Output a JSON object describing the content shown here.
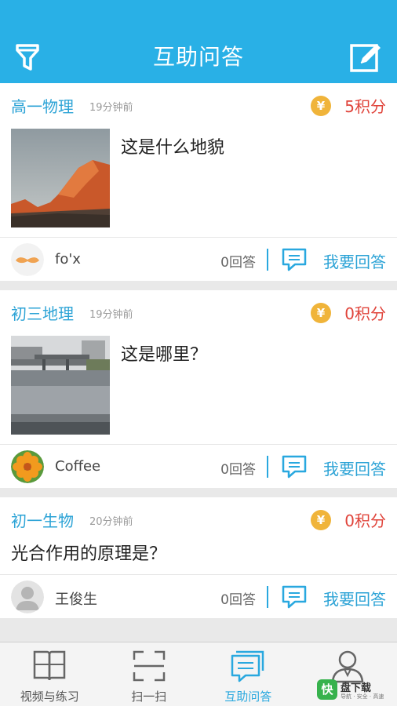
{
  "app_bar": {
    "title": "互助问答",
    "filter_icon": "filter-icon",
    "compose_icon": "compose-icon"
  },
  "questions": [
    {
      "subject": "高一物理",
      "time": "19分钟前",
      "points": "5积分",
      "question": "这是什么地貌",
      "image": "rock-landscape-photo",
      "user": "fo'x",
      "avatar": "mustache-avatar",
      "answers": "0回答",
      "reply_label": "我要回答"
    },
    {
      "subject": "初三地理",
      "time": "19分钟前",
      "points": "0积分",
      "question": "这是哪里？",
      "image": "river-bridge-photo",
      "user": "Coffee",
      "avatar": "flower-avatar",
      "answers": "0回答",
      "reply_label": "我要回答"
    },
    {
      "subject": "初一生物",
      "time": "20分钟前",
      "points": "0积分",
      "question": "光合作用的原理是？",
      "user": "王俊生",
      "avatar": "default-person-avatar",
      "answers": "0回答",
      "reply_label": "我要回答"
    }
  ],
  "coin_symbol": "¥",
  "tabs": [
    {
      "label": "视频与练习",
      "icon": "book-icon"
    },
    {
      "label": "扫一扫",
      "icon": "scan-icon"
    },
    {
      "label": "互助问答",
      "icon": "chat-icon",
      "active": true
    },
    {
      "label": "",
      "icon": "person-icon"
    }
  ],
  "watermark": {
    "badge": "快",
    "text": "盘下载",
    "sub": "导航 · 安全 · 高速"
  },
  "colors": {
    "primary": "#29b0e6",
    "accent_red": "#e0443b",
    "coin": "#f0b43a"
  }
}
